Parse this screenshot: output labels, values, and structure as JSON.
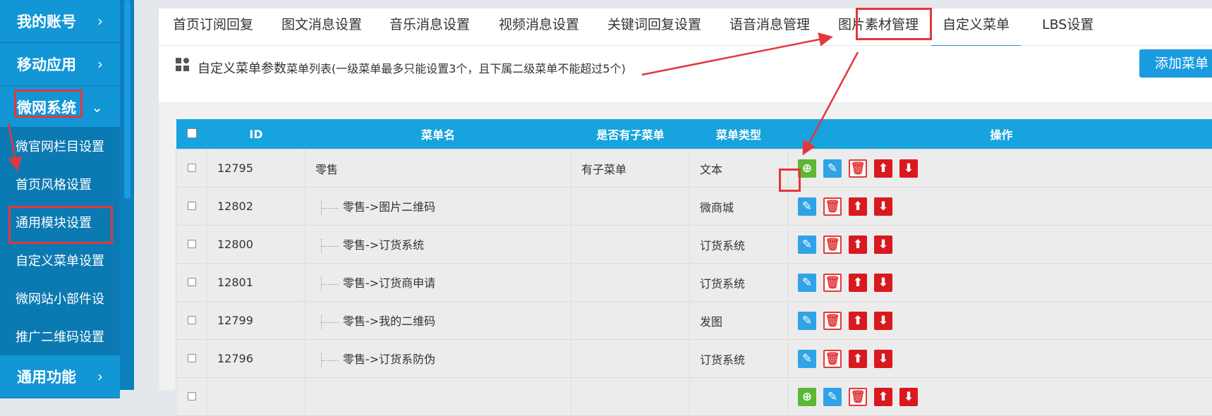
{
  "sidebar": {
    "top_items": [
      {
        "label": "我的账号",
        "chevron": "›"
      },
      {
        "label": "移动应用",
        "chevron": "›"
      },
      {
        "label": "微网系统",
        "chevron": "⌄"
      }
    ],
    "sub_items": [
      {
        "label": "微官网栏目设置"
      },
      {
        "label": "首页风格设置"
      },
      {
        "label": "通用模块设置"
      },
      {
        "label": "自定义菜单设置"
      },
      {
        "label": "微网站小部件设"
      },
      {
        "label": "推广二维码设置"
      }
    ],
    "bottom_item": {
      "label": "通用功能",
      "chevron": "›"
    }
  },
  "tabs": [
    {
      "label": "首页订阅回复"
    },
    {
      "label": "图文消息设置"
    },
    {
      "label": "音乐消息设置"
    },
    {
      "label": "视频消息设置"
    },
    {
      "label": "关键词回复设置"
    },
    {
      "label": "语音消息管理"
    },
    {
      "label": "图片素材管理"
    },
    {
      "label": "自定义菜单",
      "active": true
    },
    {
      "label": "LBS设置"
    }
  ],
  "notice": {
    "title": "自定义菜单参数",
    "hint": "菜单列表(一级菜单最多只能设置3个，且下属二级菜单不能超过5个)",
    "icon": "grid-icon"
  },
  "add_button": "添加菜单",
  "table": {
    "headers": [
      "ID",
      "菜单名",
      "是否有子菜单",
      "菜单类型",
      "操作"
    ],
    "rows": [
      {
        "id": "12795",
        "name": "零售",
        "has_sub": "有子菜单",
        "type": "文本",
        "child": false,
        "ops": [
          "add",
          "edit",
          "del",
          "up",
          "down"
        ]
      },
      {
        "id": "12802",
        "name": "零售->图片二维码",
        "has_sub": "",
        "type": "微商城",
        "child": true,
        "ops": [
          "edit",
          "del",
          "up",
          "down"
        ]
      },
      {
        "id": "12800",
        "name": "零售->订货系统",
        "has_sub": "",
        "type": "订货系统",
        "child": true,
        "ops": [
          "edit",
          "del",
          "up",
          "down"
        ]
      },
      {
        "id": "12801",
        "name": "零售->订货商申请",
        "has_sub": "",
        "type": "订货系统",
        "child": true,
        "ops": [
          "edit",
          "del",
          "up",
          "down"
        ]
      },
      {
        "id": "12799",
        "name": "零售->我的二维码",
        "has_sub": "",
        "type": "发图",
        "child": true,
        "ops": [
          "edit",
          "del",
          "up",
          "down"
        ]
      },
      {
        "id": "12796",
        "name": "零售->订货系防伪",
        "has_sub": "",
        "type": "订货系统",
        "child": true,
        "ops": [
          "edit",
          "del",
          "up",
          "down"
        ]
      },
      {
        "id": "",
        "name": "",
        "has_sub": "",
        "type": "",
        "child": false,
        "ops": [
          "add",
          "edit",
          "del",
          "up",
          "down"
        ]
      }
    ]
  },
  "icons": {
    "add": "⊕",
    "edit": "✎",
    "del": "🗑",
    "up": "⬆",
    "down": "⬇"
  },
  "colors": {
    "sidebar": "#0b86c4",
    "accent": "#1a9be0",
    "header": "#17a3dd",
    "annotation": "#e3373d"
  }
}
